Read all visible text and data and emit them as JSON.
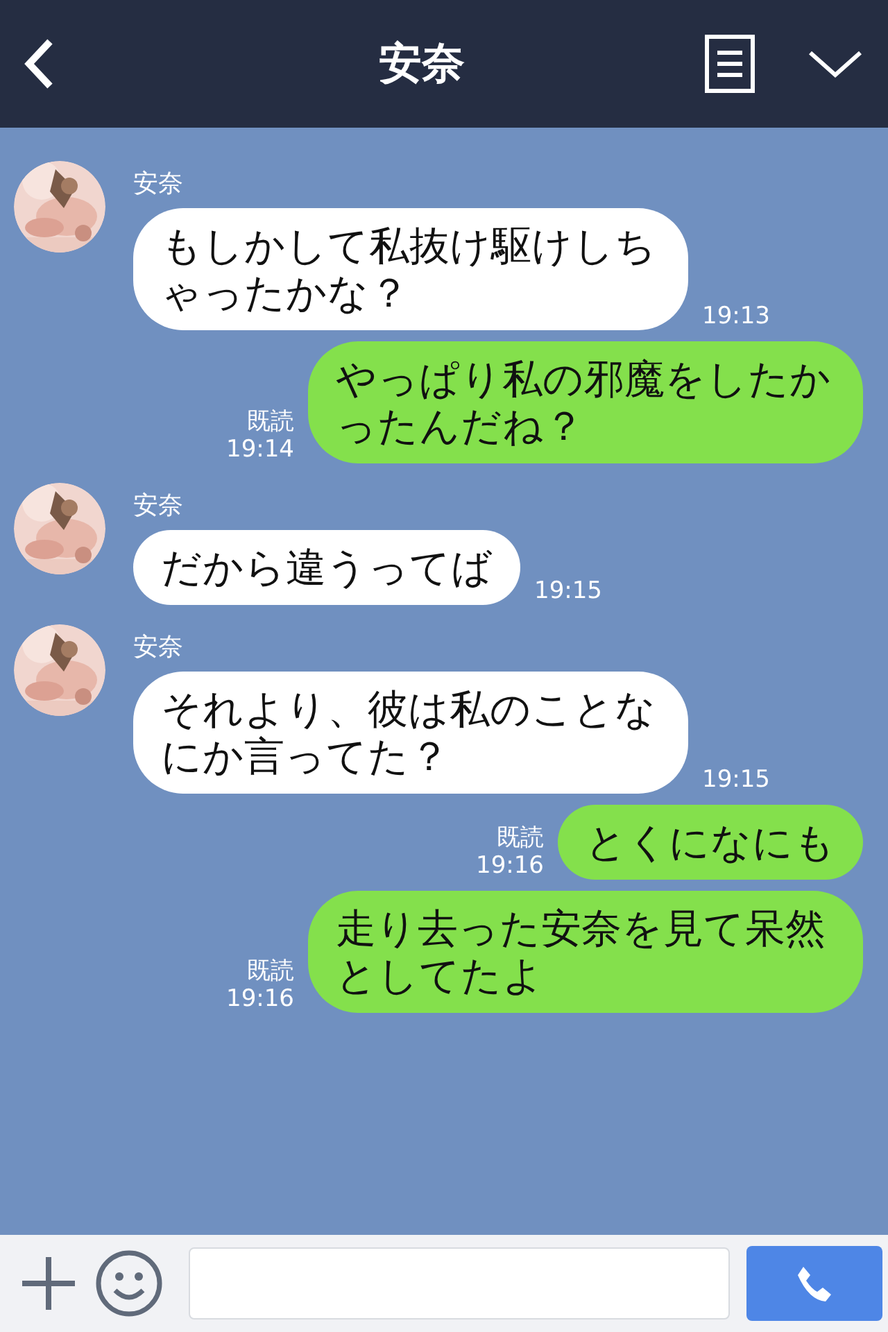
{
  "header": {
    "title": "安奈"
  },
  "messages": [
    {
      "kind": "left",
      "sender": "安奈",
      "text": "もしかして私抜け駆けしちゃったかな？",
      "time": "19:13"
    },
    {
      "kind": "right",
      "read_label": "既読",
      "text": "やっぱり私の邪魔をしたかったんだね？",
      "time": "19:14"
    },
    {
      "kind": "left",
      "sender": "安奈",
      "text": "だから違うってば",
      "time": "19:15"
    },
    {
      "kind": "left",
      "sender": "安奈",
      "text": "それより、彼は私のことなにか言ってた？",
      "time": "19:15"
    },
    {
      "kind": "right",
      "read_label": "既読",
      "text": "とくになにも",
      "time": "19:16"
    },
    {
      "kind": "right",
      "read_label": "既読",
      "text": "走り去った安奈を見て呆然としてたよ",
      "time": "19:16"
    }
  ]
}
